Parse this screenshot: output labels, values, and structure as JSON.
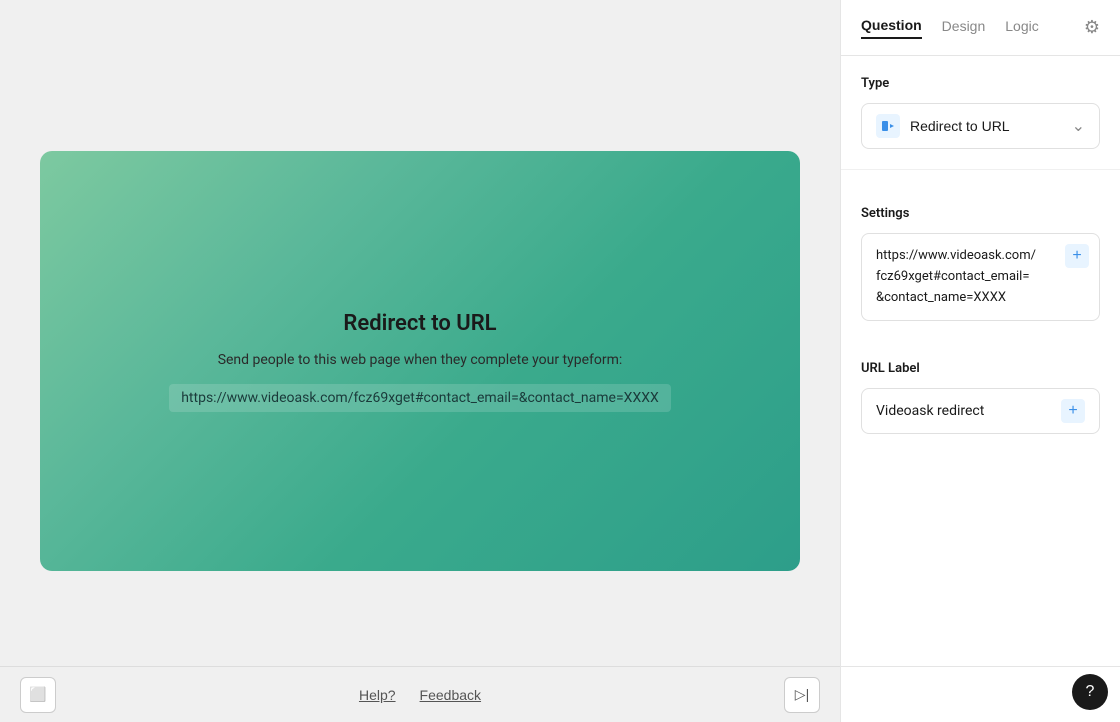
{
  "panel": {
    "tabs": [
      {
        "id": "question",
        "label": "Question",
        "active": true
      },
      {
        "id": "design",
        "label": "Design",
        "active": false
      },
      {
        "id": "logic",
        "label": "Logic",
        "active": false
      }
    ],
    "type_section": {
      "label": "Type",
      "dropdown": {
        "icon": "▶",
        "value": "Redirect to URL"
      }
    },
    "settings_section": {
      "label": "Settings",
      "url_line1": "https://www.videoask.com/",
      "url_line2": "fcz69xget#contact_email=",
      "url_line3": "&contact_name=XXXX",
      "plus_icon": "+"
    },
    "url_label_section": {
      "label": "URL Label",
      "value": "Videoask redirect",
      "plus_icon": "+"
    }
  },
  "preview": {
    "title": "Redirect to URL",
    "subtitle": "Send people to this web page when they complete your typeform:",
    "url": "https://www.videoask.com/fcz69xget#contact_email=&contact_name=XXXX"
  },
  "bottom_bar": {
    "help_label": "Help?",
    "feedback_label": "Feedback",
    "collapse_icon": "❮",
    "expand_icon": "❯"
  },
  "help_button": "?"
}
